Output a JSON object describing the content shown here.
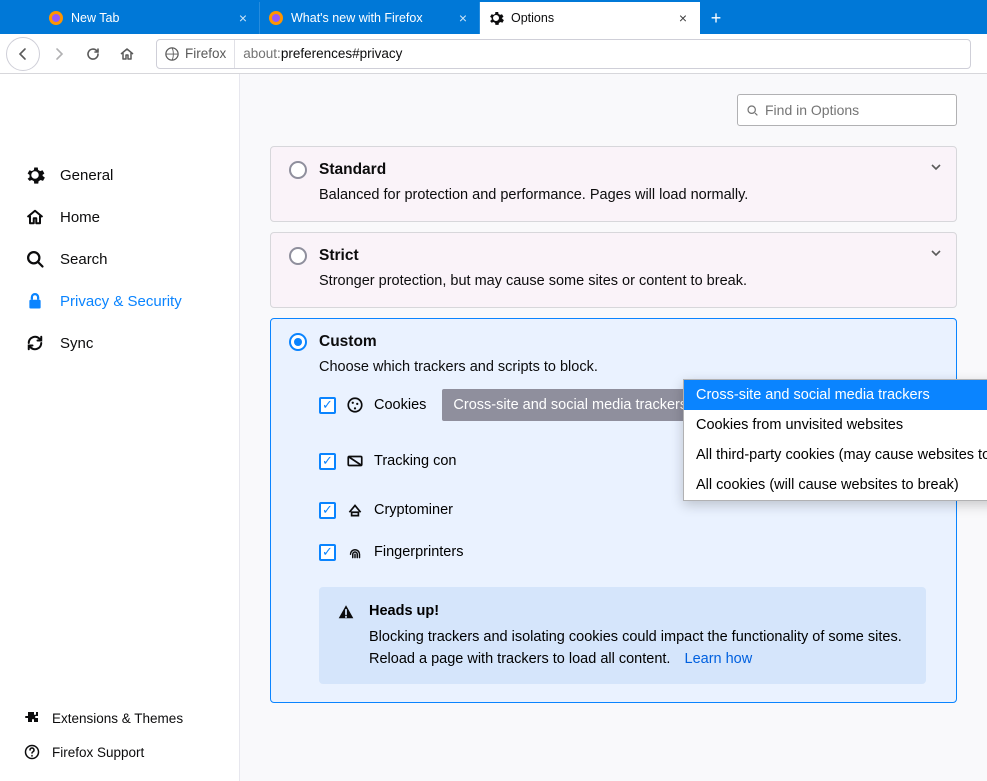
{
  "tabs": {
    "items": [
      {
        "label": "New Tab",
        "active": false
      },
      {
        "label": "What's new with Firefox",
        "active": false
      },
      {
        "label": "Options",
        "active": true
      }
    ]
  },
  "url": {
    "identity": "Firefox",
    "prefix": "about:",
    "path": "preferences#privacy"
  },
  "sidebar": {
    "items": [
      {
        "label": "General",
        "icon": "gear"
      },
      {
        "label": "Home",
        "icon": "home"
      },
      {
        "label": "Search",
        "icon": "search"
      },
      {
        "label": "Privacy & Security",
        "icon": "lock",
        "active": true
      },
      {
        "label": "Sync",
        "icon": "sync"
      }
    ],
    "footer": [
      {
        "label": "Extensions & Themes",
        "icon": "puzzle"
      },
      {
        "label": "Firefox Support",
        "icon": "question"
      }
    ]
  },
  "searchOptions": {
    "placeholder": "Find in Options"
  },
  "panels": {
    "standard": {
      "title": "Standard",
      "desc": "Balanced for protection and performance. Pages will load normally."
    },
    "strict": {
      "title": "Strict",
      "desc": "Stronger protection, but may cause some sites or content to break."
    },
    "custom": {
      "title": "Custom",
      "desc": "Choose which trackers and scripts to block.",
      "cookies": {
        "label": "Cookies",
        "selected": "Cross-site and social media trackers"
      },
      "tracking": {
        "label": "Tracking con"
      },
      "crypto": {
        "label": "Cryptominer"
      },
      "fingerprint": {
        "label": "Fingerprinters"
      },
      "dropdown": [
        "Cross-site and social media trackers",
        "Cookies from unvisited websites",
        "All third-party cookies (may cause websites to break)",
        "All cookies (will cause websites to break)"
      ],
      "alert": {
        "title": "Heads up!",
        "body": "Blocking trackers and isolating cookies could impact the functionality of some sites. Reload a page with trackers to load all content.",
        "link": "Learn how"
      }
    }
  }
}
